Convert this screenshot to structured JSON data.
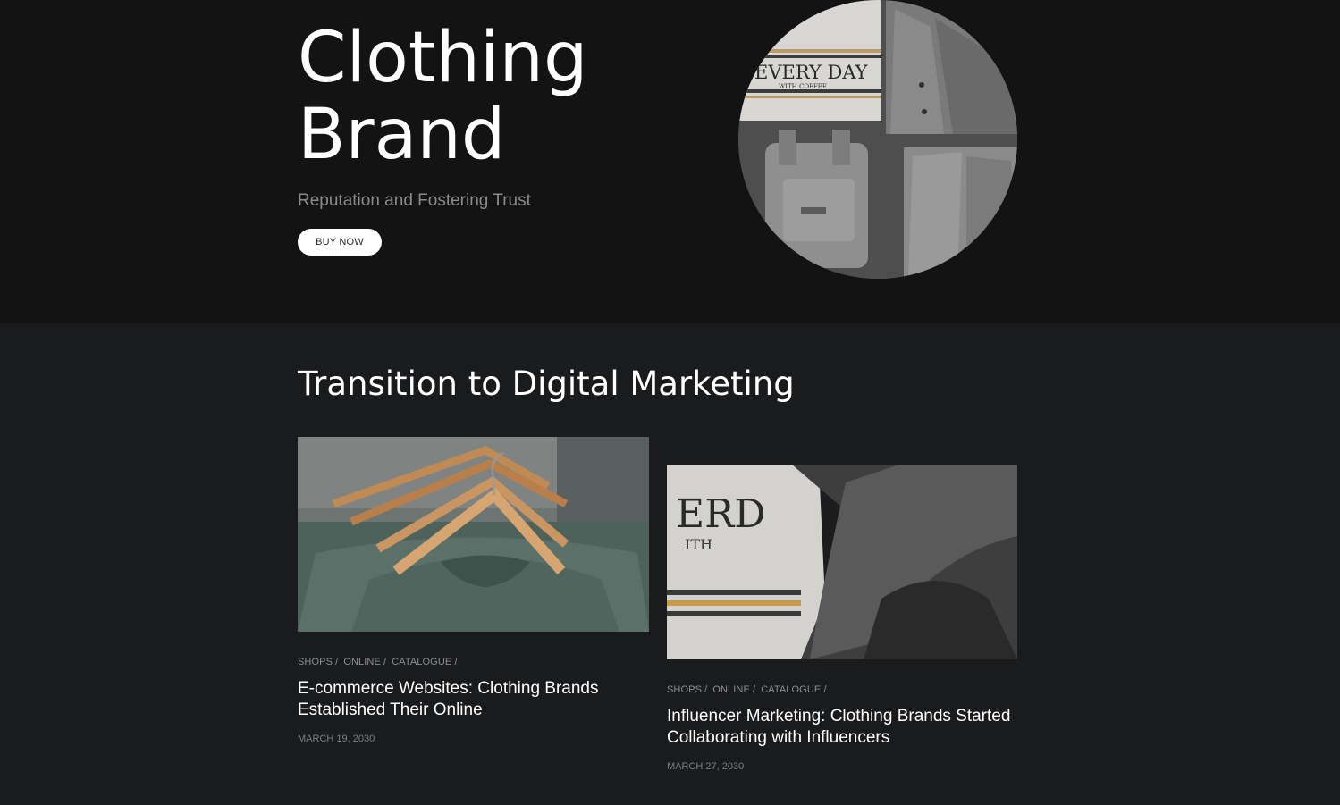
{
  "hero": {
    "title_line1": "Clothing",
    "title_line2": "Brand",
    "subtitle": "Reputation and Fostering Trust",
    "button_label": "BUY NOW"
  },
  "section": {
    "title": "Transition to Digital Marketing"
  },
  "cards": [
    {
      "tags": [
        "SHOPS /",
        "ONLINE /",
        "CATALOGUE /"
      ],
      "title": "E-commerce Websites: Clothing Brands Established Their Online",
      "date": "MARCH 19, 2030"
    },
    {
      "tags": [
        "SHOPS /",
        "ONLINE /",
        "CATALOGUE /"
      ],
      "title": "Influencer Marketing: Clothing Brands Started Collaborating with Influencers",
      "date": "MARCH 27, 2030"
    }
  ],
  "colors": {
    "hero_bg": "#131314",
    "page_bg": "#1a1b1d",
    "subtitle": "#8a8b8d"
  }
}
